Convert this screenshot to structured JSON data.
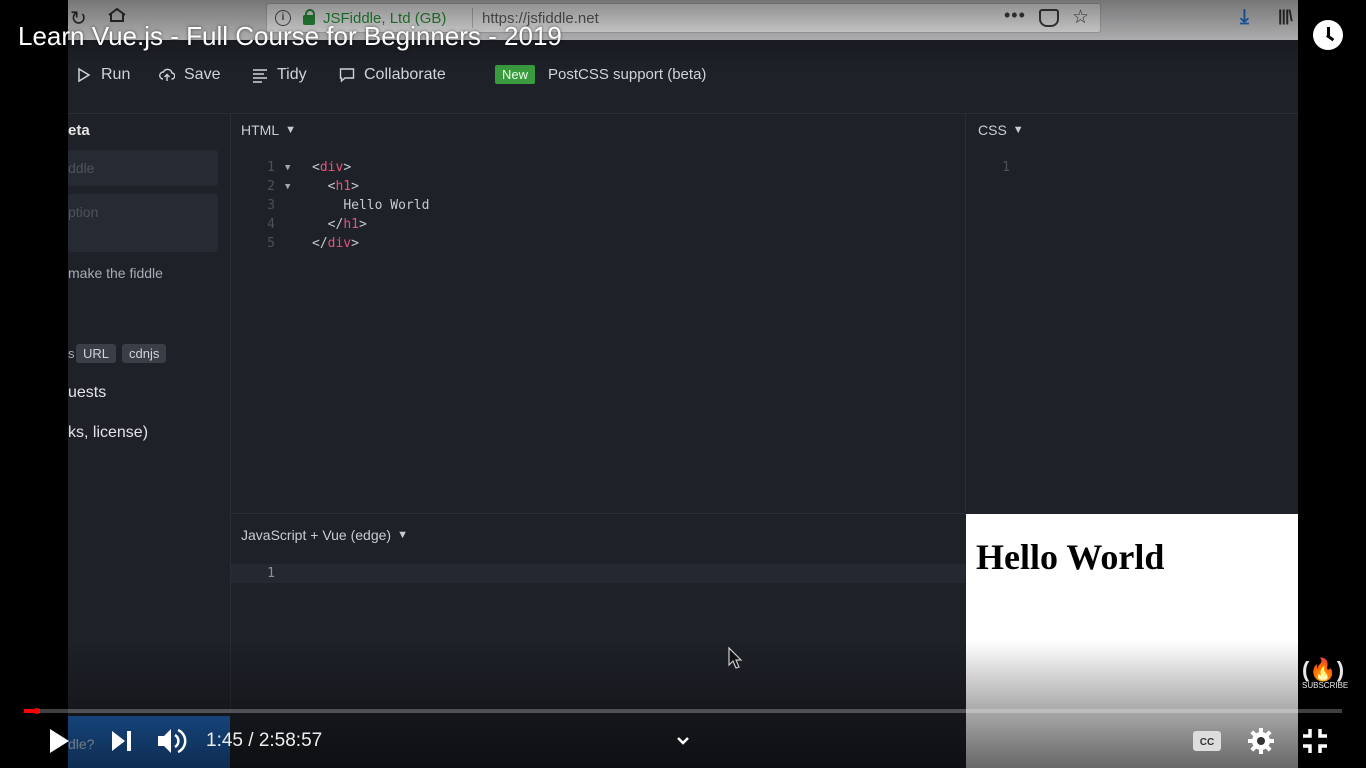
{
  "browser": {
    "company": "JSFiddle, Ltd (GB)",
    "url": "https://jsfiddle.net"
  },
  "toolbar": {
    "run_label": "Run",
    "save_label": "Save",
    "tidy_label": "Tidy",
    "collaborate_label": "Collaborate",
    "new_badge": "New",
    "promo_text": "PostCSS support (beta)"
  },
  "sidebar": {
    "title_fragment": "eta",
    "name_placeholder_fragment": "ddle",
    "description_placeholder_fragment": "ption",
    "public_text_fragment": "make the fiddle",
    "resource_tabs": [
      "s",
      "URL",
      "cdnjs"
    ],
    "requests_fragment": "uests",
    "license_fragment": "ks, license)"
  },
  "editors": {
    "html_label": "HTML",
    "css_label": "CSS",
    "js_label": "JavaScript + Vue (edge)",
    "html_code": [
      {
        "n": "1",
        "indent": "",
        "open": "<",
        "tag": "div",
        "close": ">",
        "fold": true
      },
      {
        "n": "2",
        "indent": "  ",
        "open": "<",
        "tag": "h1",
        "close": ">",
        "fold": true
      },
      {
        "n": "3",
        "indent": "    ",
        "text": "Hello World"
      },
      {
        "n": "4",
        "indent": "  ",
        "open": "</",
        "tag": "h1",
        "close": ">"
      },
      {
        "n": "5",
        "indent": "",
        "open": "</",
        "tag": "div",
        "close": ">"
      }
    ],
    "css_line_number": "1",
    "js_line_number": "1"
  },
  "result": {
    "heading": "Hello World"
  },
  "player": {
    "video_title": "Learn Vue.js - Full Course for Beginners - 2019",
    "current_time": "1:45",
    "duration": "2:58:57",
    "time_display": "1:45 / 2:58:57",
    "progress_fraction": 0.0098,
    "loaded_fraction": 0.012,
    "subscribe_label": "SUBSCRIBE",
    "bottom_fragment": "dle?"
  },
  "colors": {
    "progress_played": "#ff0000",
    "new_badge": "#3a9a3e",
    "code_tag": "#e0577a",
    "editor_bg": "#1e2128"
  }
}
